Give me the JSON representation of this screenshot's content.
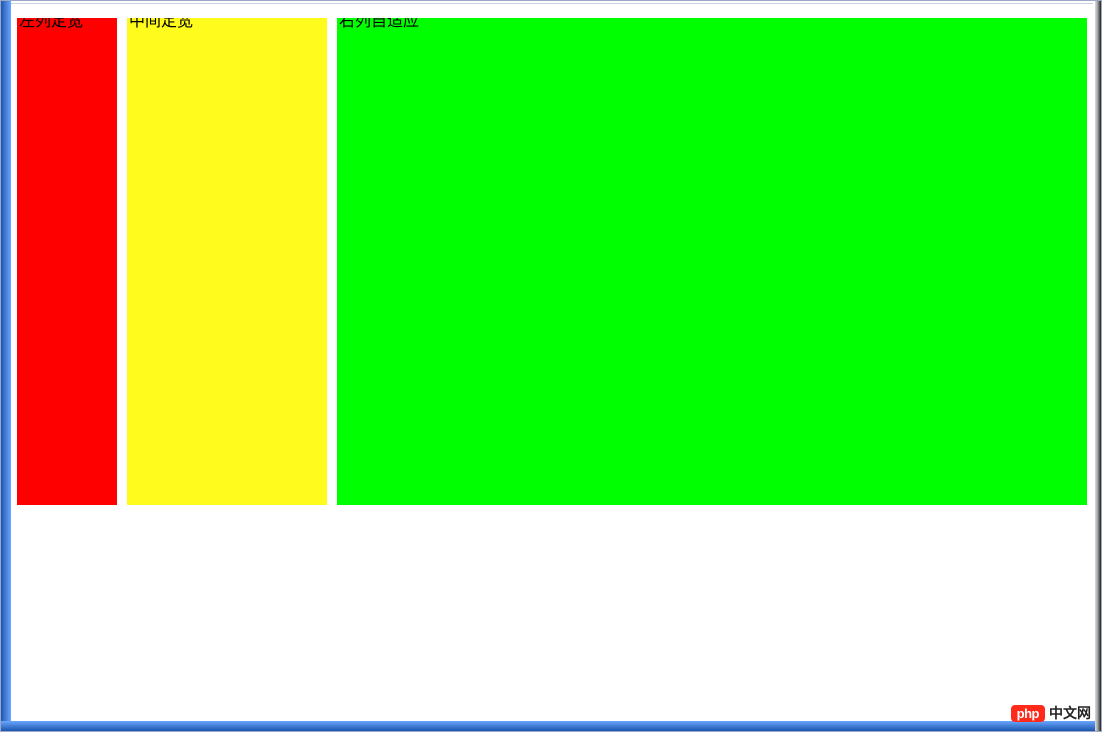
{
  "columns": {
    "left_label": "左列定宽",
    "mid_label": "中间定宽",
    "right_label": "右列自适应"
  },
  "watermark": {
    "badge": "php",
    "text": "中文网"
  },
  "colors": {
    "left": "#ff0000",
    "mid": "#fffc1d",
    "right": "#00ff00"
  }
}
